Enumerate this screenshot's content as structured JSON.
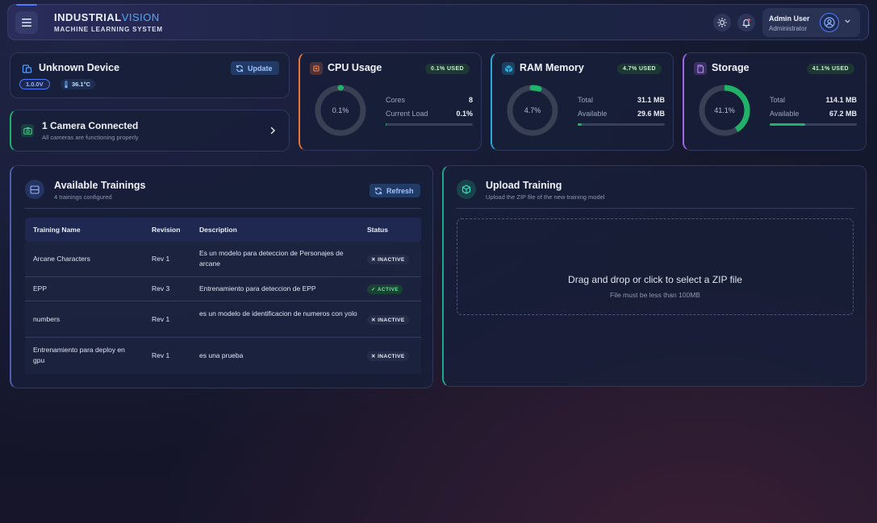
{
  "header": {
    "logo_part1": "INDUSTRIAL",
    "logo_part2": "VISION",
    "logo_sub": "MACHINE LEARNING SYSTEM",
    "user_name": "Admin User",
    "user_role": "Administrator"
  },
  "device": {
    "title": "Unknown Device",
    "update_label": "Update",
    "voltage": "1.0.0V",
    "temperature": "36.1°C"
  },
  "camera": {
    "title": "1 Camera Connected",
    "subtitle": "All cameras are functioning properly"
  },
  "cpu": {
    "title": "CPU Usage",
    "badge": "0.1% USED",
    "percent_label": "0.1%",
    "percent": 0.1,
    "cores_label": "Cores",
    "cores_value": "8",
    "load_label": "Current Load",
    "load_value": "0.1%",
    "accent": "#e8753a"
  },
  "ram": {
    "title": "RAM Memory",
    "badge": "4.7% USED",
    "percent_label": "4.7%",
    "percent": 4.7,
    "total_label": "Total",
    "total_value": "31.1 MB",
    "available_label": "Available",
    "available_value": "29.6 MB",
    "accent": "#2aa8d8"
  },
  "storage": {
    "title": "Storage",
    "badge": "41.1% USED",
    "percent_label": "41.1%",
    "percent": 41.1,
    "total_label": "Total",
    "total_value": "114.1 MB",
    "available_label": "Available",
    "available_value": "67.2 MB",
    "accent": "#a266e8"
  },
  "trainings": {
    "title": "Available Trainings",
    "subtitle": "4 trainings configured",
    "refresh_label": "Refresh",
    "columns": [
      "Training Name",
      "Revision",
      "Description",
      "Status"
    ],
    "rows": [
      {
        "name": "Arcane Characters",
        "rev": "Rev 1",
        "desc": "Es un modelo para deteccion de Personajes de arcane",
        "status": "INACTIVE"
      },
      {
        "name": "EPP",
        "rev": "Rev 3",
        "desc": "Entrenamiento para deteccion de EPP",
        "status": "ACTIVE"
      },
      {
        "name": "numbers",
        "rev": "Rev 1",
        "desc": "es un modelo de identificacion de numeros con yolo",
        "status": "INACTIVE"
      },
      {
        "name": "Entrenamiento para deploy en gpu",
        "rev": "Rev 1",
        "desc": "es una prueba",
        "status": "INACTIVE"
      }
    ]
  },
  "upload": {
    "title": "Upload Training",
    "subtitle": "Upload the ZIP file of the new training model",
    "drop_text": "Drag and drop or click to select a ZIP file",
    "drop_hint": "File must be less than 100MB"
  },
  "colors": {
    "accent_blue": "#4f7cff",
    "success_green": "#20b268"
  }
}
